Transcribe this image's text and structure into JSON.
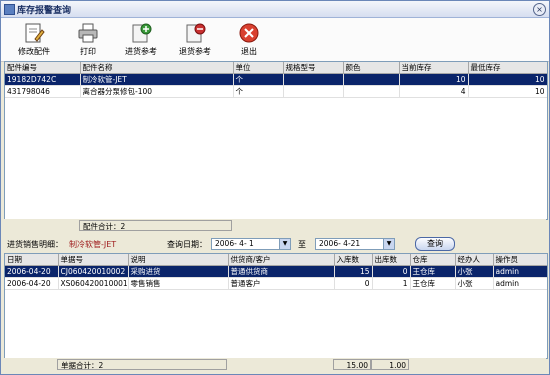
{
  "window": {
    "title": "库存报警查询",
    "close_glyph": "×"
  },
  "toolbar": [
    {
      "label": "修改配件",
      "icon": "edit-parts-icon"
    },
    {
      "label": "打印",
      "icon": "printer-icon"
    },
    {
      "label": "进货参考",
      "icon": "purchase-reference-icon"
    },
    {
      "label": "退货参考",
      "icon": "return-reference-icon"
    },
    {
      "label": "退出",
      "icon": "exit-icon"
    }
  ],
  "parts_table": {
    "columns": [
      "配件编号",
      "配件名称",
      "单位",
      "规格型号",
      "颜色",
      "当前库存",
      "最低库存"
    ],
    "rows": [
      {
        "code": "19182D742C",
        "name": "制冷软管-JET",
        "unit": "个",
        "spec": "",
        "color": "",
        "stock": "10",
        "min_stock": "10",
        "selected": true
      },
      {
        "code": "431798046",
        "name": "离合器分泵修包-100",
        "unit": "个",
        "spec": "",
        "color": "",
        "stock": "4",
        "min_stock": "10",
        "selected": false
      }
    ],
    "summary": "配件合计：2"
  },
  "detail_bar": {
    "label": "进货销售明细：",
    "part_name": "制冷软管-JET",
    "date_label": "查询日期：",
    "date_from": "2006- 4- 1",
    "to_label": "至",
    "date_to": "2006- 4-21",
    "query_button": "查询"
  },
  "detail_table": {
    "columns": [
      "日期",
      "单据号",
      "说明",
      "供货商/客户",
      "入库数",
      "出库数",
      "仓库",
      "经办人",
      "操作员"
    ],
    "rows": [
      {
        "date": "2006-04-20",
        "doc": "CJ060420010002",
        "desc": "采购进货",
        "party": "普通供货商",
        "in": "15",
        "out": "0",
        "store": "王仓库",
        "handler": "小张",
        "operator": "admin",
        "selected": true
      },
      {
        "date": "2006-04-20",
        "doc": "XS060420010001",
        "desc": "零售销售",
        "party": "普通客户",
        "in": "0",
        "out": "1",
        "store": "王仓库",
        "handler": "小张",
        "operator": "admin",
        "selected": false
      }
    ],
    "summary": "单据合计：2",
    "total_in": "15.00",
    "total_out": "1.00"
  }
}
